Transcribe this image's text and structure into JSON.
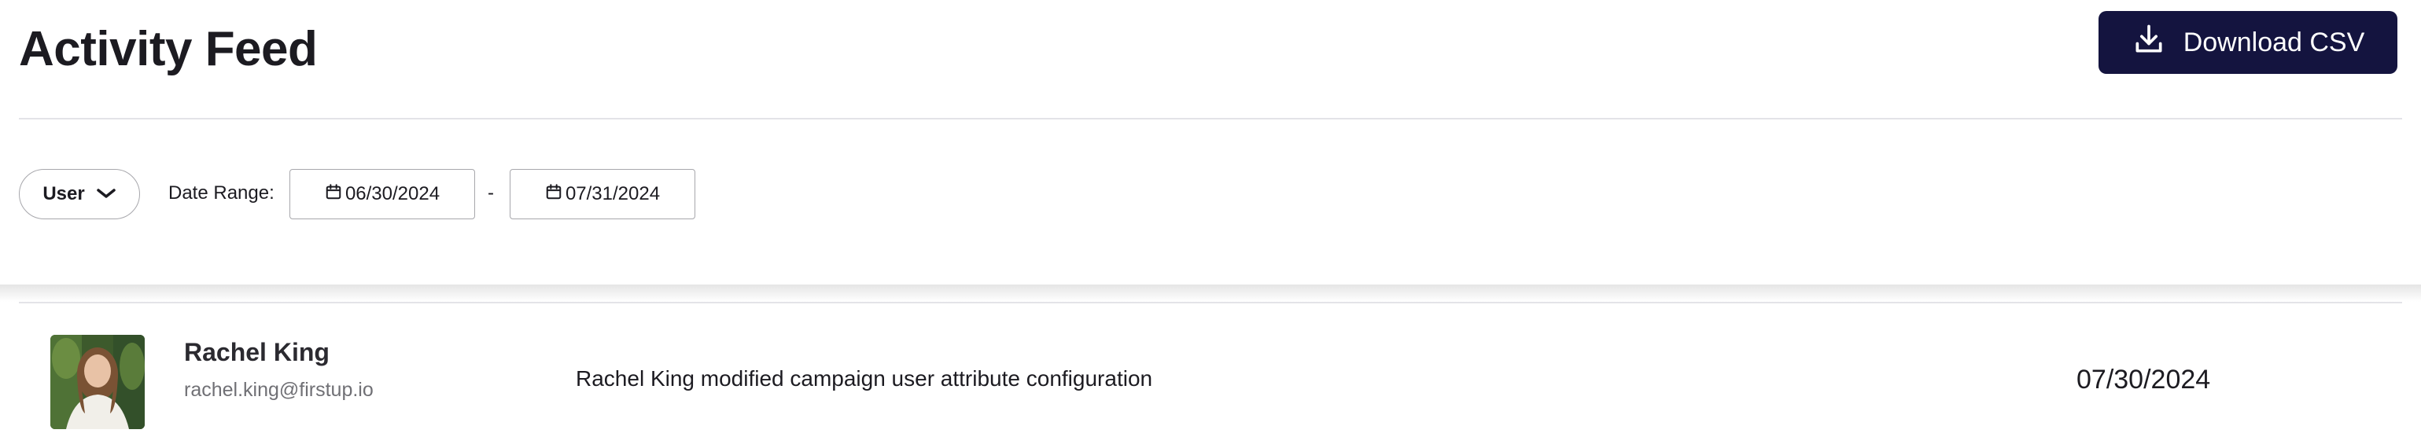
{
  "header": {
    "title": "Activity Feed",
    "download_label": "Download CSV"
  },
  "filters": {
    "user_label": "User",
    "date_range_label": "Date Range:",
    "date_from": "06/30/2024",
    "separator": "-",
    "date_to": "07/31/2024"
  },
  "activities": [
    {
      "name": "Rachel King",
      "email": "rachel.king@firstup.io",
      "description": "Rachel King modified campaign user attribute configuration",
      "date": "07/30/2024"
    }
  ],
  "colors": {
    "button_bg": "#14143f",
    "text": "#1c1b21",
    "muted": "#707075",
    "border": "#a7a7ac"
  }
}
